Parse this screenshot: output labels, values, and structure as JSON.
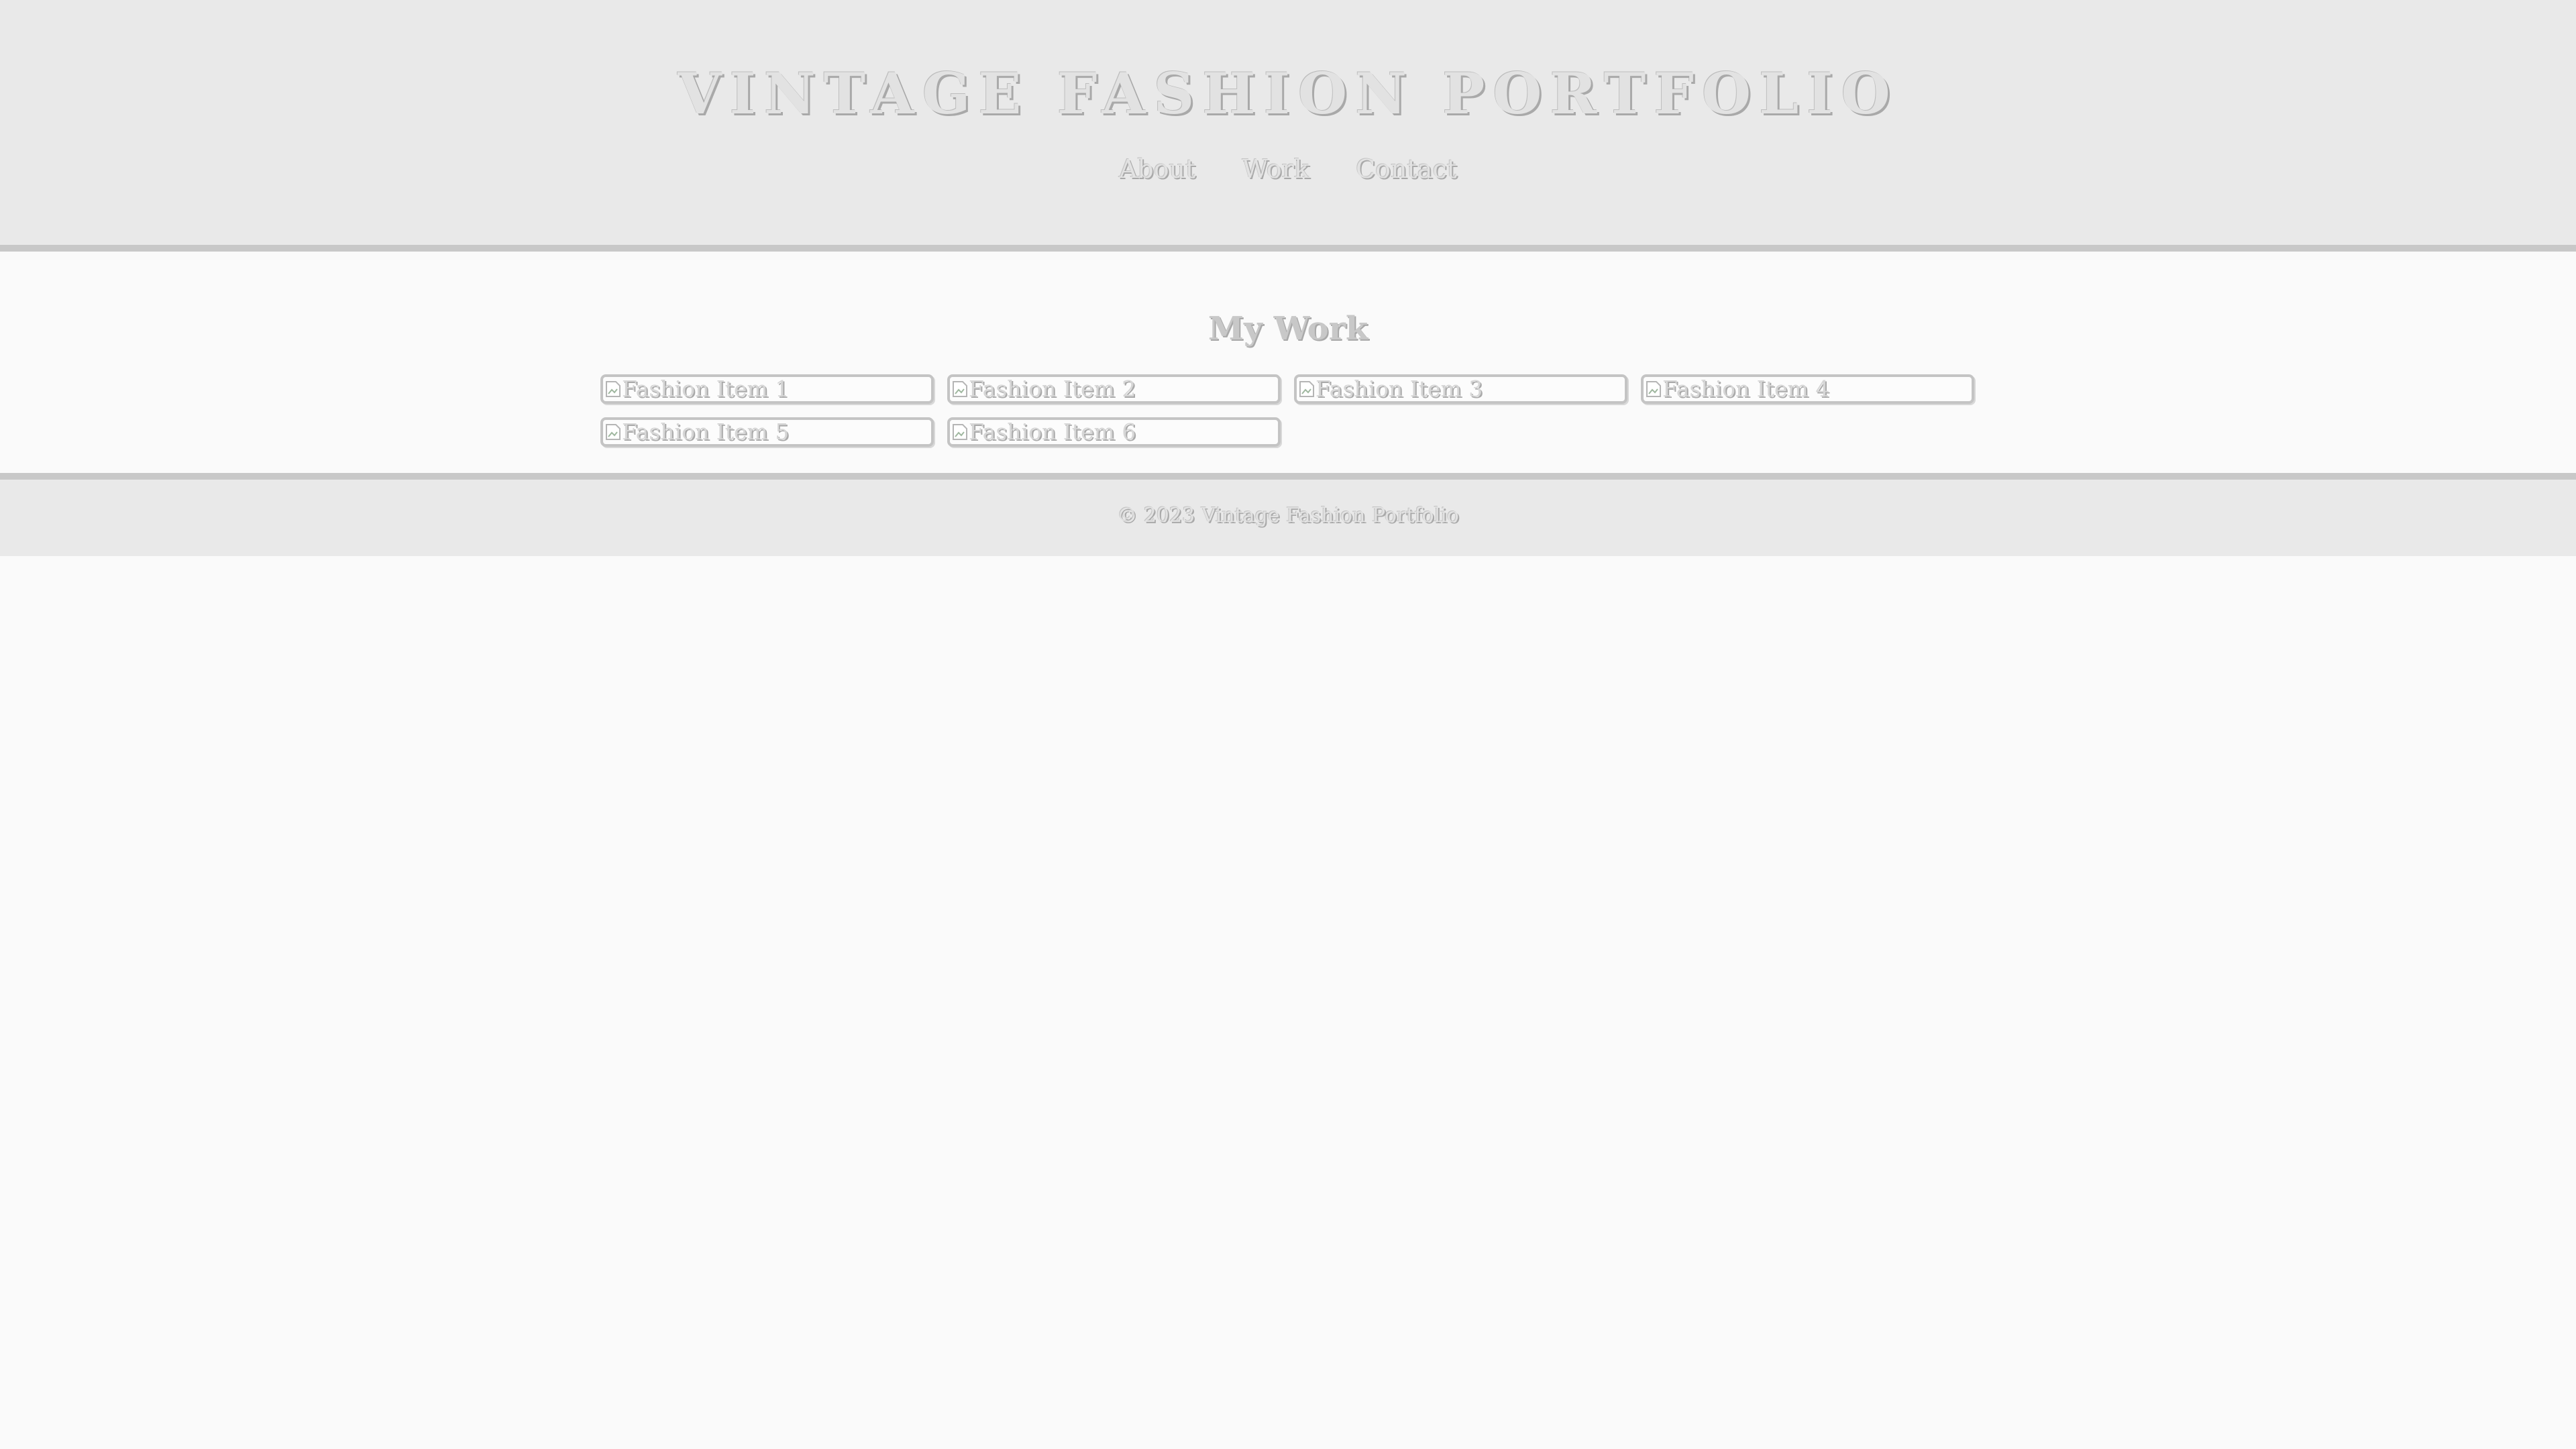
{
  "header": {
    "title": "VINTAGE FASHION PORTFOLIO",
    "nav": [
      {
        "label": "About"
      },
      {
        "label": "Work"
      },
      {
        "label": "Contact"
      }
    ]
  },
  "main": {
    "section_title": "My Work",
    "items": [
      {
        "alt": "Fashion Item 1"
      },
      {
        "alt": "Fashion Item 2"
      },
      {
        "alt": "Fashion Item 3"
      },
      {
        "alt": "Fashion Item 4"
      },
      {
        "alt": "Fashion Item 5"
      },
      {
        "alt": "Fashion Item 6"
      }
    ],
    "item_icon": "broken-image-icon"
  },
  "footer": {
    "text": "© 2023 Vintage Fashion Portfolio"
  },
  "colors": {
    "header_bg": "#e9e9e9",
    "page_bg": "#fafafa",
    "divider": "#c8c8c8",
    "text_shadow": "#a9a9a9"
  }
}
